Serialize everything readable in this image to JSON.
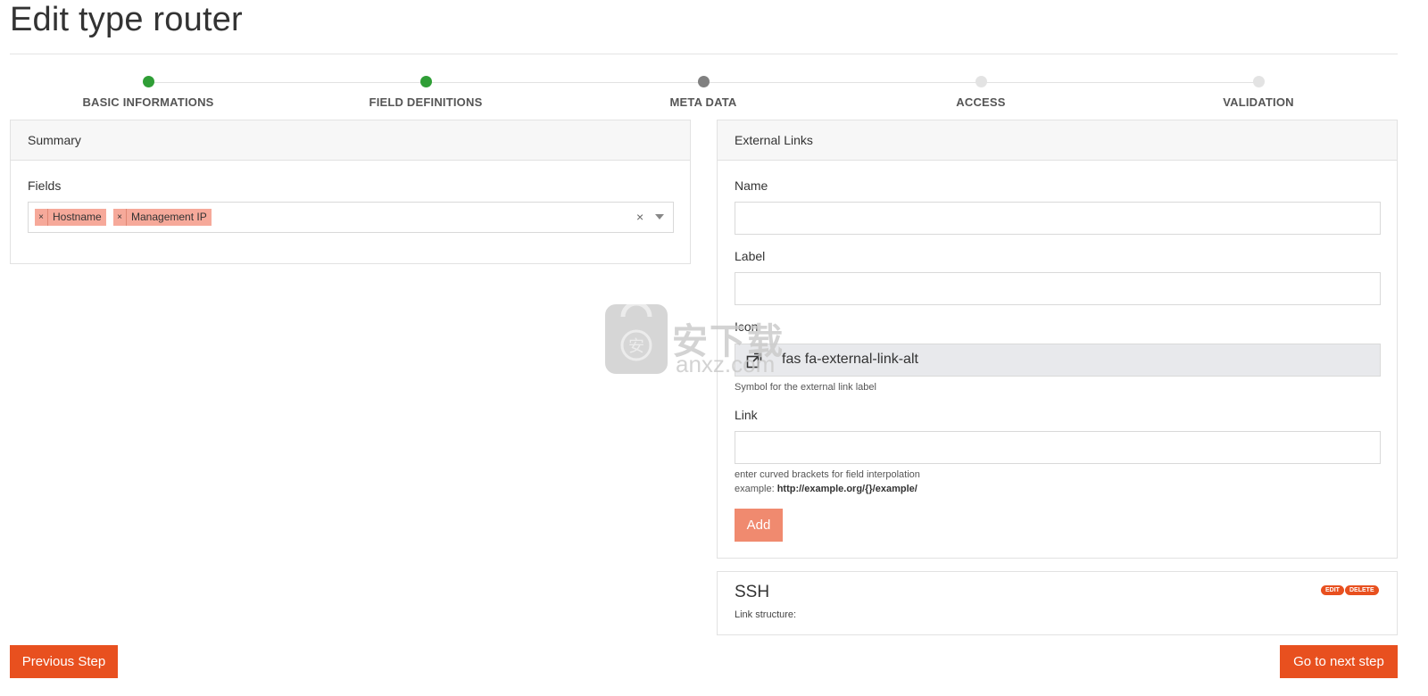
{
  "page": {
    "title": "Edit type router"
  },
  "stepper": {
    "steps": [
      {
        "label": "BASIC INFORMATIONS",
        "state": "done"
      },
      {
        "label": "FIELD DEFINITIONS",
        "state": "done"
      },
      {
        "label": "META DATA",
        "state": "current"
      },
      {
        "label": "ACCESS",
        "state": "pending"
      },
      {
        "label": "VALIDATION",
        "state": "pending"
      }
    ]
  },
  "summary": {
    "header": "Summary",
    "fields_label": "Fields",
    "selected_fields": [
      "Hostname",
      "Management IP"
    ],
    "remove_glyph": "×",
    "clear_glyph": "×"
  },
  "external_links": {
    "header": "External Links",
    "name_label": "Name",
    "name_value": "",
    "label_label": "Label",
    "label_value": "",
    "icon_label": "Icon",
    "icon_value": "fas fa-external-link-alt",
    "icon_help": "Symbol for the external link label",
    "link_label": "Link",
    "link_value": "",
    "link_help_line1": "enter curved brackets for field interpolation",
    "link_help_prefix": "example: ",
    "link_help_example": "http://example.org/{}/example/",
    "add_button": "Add"
  },
  "link_item": {
    "title": "SSH",
    "subtitle": "Link structure:",
    "edit_badge": "EDIT",
    "delete_badge": "DELETE"
  },
  "navigation": {
    "previous_label": "Previous Step",
    "next_label": "Go to next step"
  },
  "watermark": {
    "cn_text": "安下载",
    "en_text": "anxz.com",
    "glyph": "安"
  },
  "colors": {
    "accent": "#e8501f",
    "add_button": "#f08a6f",
    "tag_bg": "#f6a99a",
    "step_done": "#2f9e36",
    "step_current": "#808080",
    "step_pending": "#e3e3e3"
  }
}
